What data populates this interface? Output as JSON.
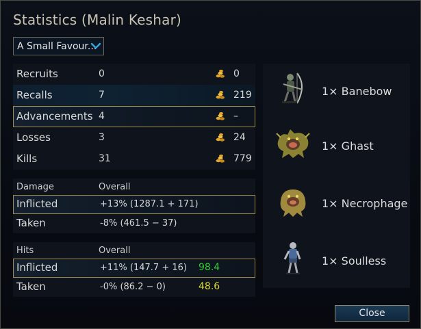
{
  "window": {
    "title": "Statistics (Malin Keshar)"
  },
  "scenario_select": {
    "value": "A Small Favour..."
  },
  "summary": [
    {
      "label": "Recruits",
      "count": "0",
      "gold": "0"
    },
    {
      "label": "Recalls",
      "count": "7",
      "gold": "219"
    },
    {
      "label": "Advancements",
      "count": "4",
      "gold": "–"
    },
    {
      "label": "Losses",
      "count": "3",
      "gold": "24"
    },
    {
      "label": "Kills",
      "count": "31",
      "gold": "779"
    }
  ],
  "damage": {
    "header": "Damage",
    "header_overall": "Overall",
    "inflicted": {
      "label": "Inflicted",
      "value": "+13% (1287.1 + 171)"
    },
    "taken": {
      "label": "Taken",
      "value": "-8% (461.5 − 37)"
    }
  },
  "hits": {
    "header": "Hits",
    "header_overall": "Overall",
    "inflicted": {
      "label": "Inflicted",
      "value": "+11% (147.7 + 16)",
      "extra": "98.4"
    },
    "taken": {
      "label": "Taken",
      "value": "-0% (86.2 − 0)",
      "extra": "48.6"
    }
  },
  "units": [
    {
      "name": "1× Banebow",
      "icon": "banebow-sprite"
    },
    {
      "name": "1× Ghast",
      "icon": "ghast-sprite"
    },
    {
      "name": "1× Necrophage",
      "icon": "necrophage-sprite"
    },
    {
      "name": "1× Soulless",
      "icon": "soulless-sprite"
    }
  ],
  "buttons": {
    "close": "Close"
  },
  "colors": {
    "accent_border": "#a08d52",
    "good_value": "#33cc33",
    "mid_value": "#d9d92e",
    "gold_icon": "#e0a52a"
  }
}
